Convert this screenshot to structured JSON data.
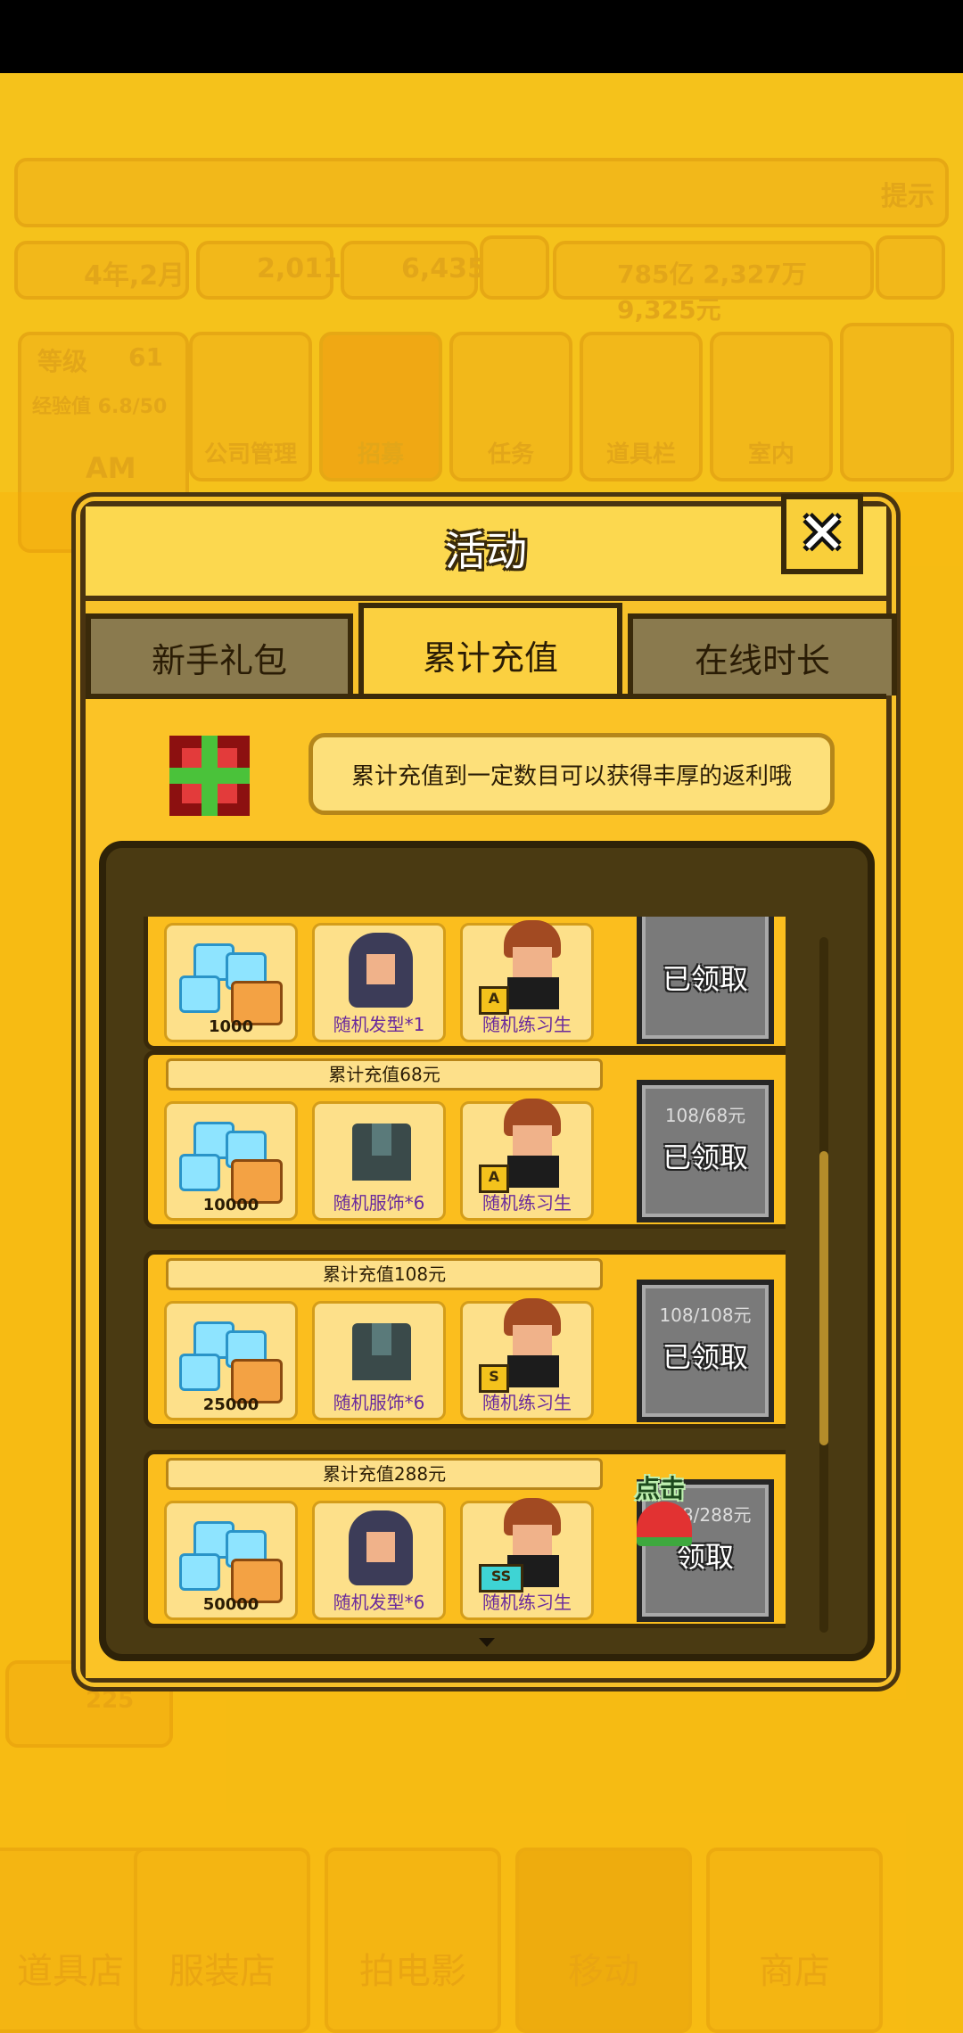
{
  "background": {
    "date": "4年,2月",
    "coins": "2,011",
    "gems": "6,435",
    "money": "785亿 2,327万 9,325元",
    "hint_button": "提示",
    "level_label": "等级",
    "level_value": "61",
    "exp_label": "经验值 6.8/50",
    "time_of_day": "AM",
    "menu": [
      "公司管理",
      "招募",
      "任务",
      "道具栏",
      "室内"
    ],
    "side_count": "225",
    "bottom_tabs": [
      "道具店",
      "服装店",
      "拍电影",
      "移动",
      "商店"
    ]
  },
  "dialog": {
    "title": "活动",
    "tabs": [
      "新手礼包",
      "累计充值",
      "在线时长"
    ],
    "tip": "累计充值到一定数目可以获得丰厚的返利哦",
    "rows": [
      {
        "label": "",
        "items": [
          {
            "type": "diamond",
            "qty": "1000"
          },
          {
            "type": "hair",
            "name": "随机发型*1"
          },
          {
            "type": "trainee",
            "name": "随机练习生",
            "badge": "A"
          }
        ],
        "progress": "",
        "button": "已领取"
      },
      {
        "label": "累计充值68元",
        "items": [
          {
            "type": "diamond",
            "qty": "10000"
          },
          {
            "type": "clothes",
            "name": "随机服饰*6"
          },
          {
            "type": "trainee",
            "name": "随机练习生",
            "badge": "A"
          }
        ],
        "progress": "108/68元",
        "button": "已领取"
      },
      {
        "label": "累计充值108元",
        "items": [
          {
            "type": "diamond",
            "qty": "25000"
          },
          {
            "type": "clothes",
            "name": "随机服饰*6"
          },
          {
            "type": "trainee",
            "name": "随机练习生",
            "badge": "S"
          }
        ],
        "progress": "108/108元",
        "button": "已领取"
      },
      {
        "label": "累计充值288元",
        "items": [
          {
            "type": "diamond",
            "qty": "50000"
          },
          {
            "type": "hair",
            "name": "随机发型*6"
          },
          {
            "type": "trainee",
            "name": "随机练习生",
            "badge": "SS"
          }
        ],
        "progress": "108/288元",
        "button": "领取"
      }
    ],
    "hint_text": "点击"
  },
  "colors": {
    "page_bg": "#f5c21b",
    "dialog_bg": "#fbc326",
    "claimed_button": "#7a7a7a",
    "item_name": "#6a2a9c"
  }
}
